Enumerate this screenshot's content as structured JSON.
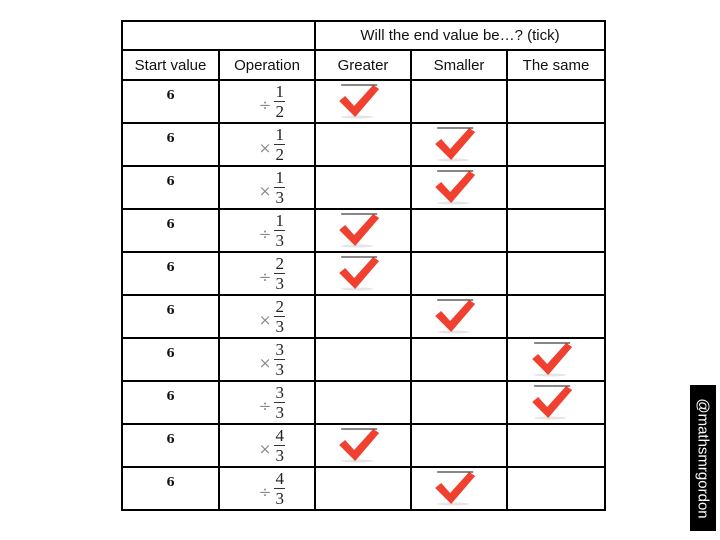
{
  "table": {
    "group_header": "Will the end value be…? (tick)",
    "columns": [
      "Start value",
      "Operation",
      "Greater",
      "Smaller",
      "The same"
    ],
    "rows": [
      {
        "start": "6",
        "op_symbol": "÷",
        "numerator": "1",
        "denominator": "2",
        "answer": "Greater"
      },
      {
        "start": "6",
        "op_symbol": "×",
        "numerator": "1",
        "denominator": "2",
        "answer": "Smaller"
      },
      {
        "start": "6",
        "op_symbol": "×",
        "numerator": "1",
        "denominator": "3",
        "answer": "Smaller"
      },
      {
        "start": "6",
        "op_symbol": "÷",
        "numerator": "1",
        "denominator": "3",
        "answer": "Greater"
      },
      {
        "start": "6",
        "op_symbol": "÷",
        "numerator": "2",
        "denominator": "3",
        "answer": "Greater"
      },
      {
        "start": "6",
        "op_symbol": "×",
        "numerator": "2",
        "denominator": "3",
        "answer": "Smaller"
      },
      {
        "start": "6",
        "op_symbol": "×",
        "numerator": "3",
        "denominator": "3",
        "answer": "The same"
      },
      {
        "start": "6",
        "op_symbol": "÷",
        "numerator": "3",
        "denominator": "3",
        "answer": "The same"
      },
      {
        "start": "6",
        "op_symbol": "×",
        "numerator": "4",
        "denominator": "3",
        "answer": "Greater"
      },
      {
        "start": "6",
        "op_symbol": "÷",
        "numerator": "4",
        "denominator": "3",
        "answer": "Smaller"
      }
    ]
  },
  "tick_icon": "check-mark-icon",
  "tick_color": "#f04030",
  "watermark": "@mathsmrgordon"
}
